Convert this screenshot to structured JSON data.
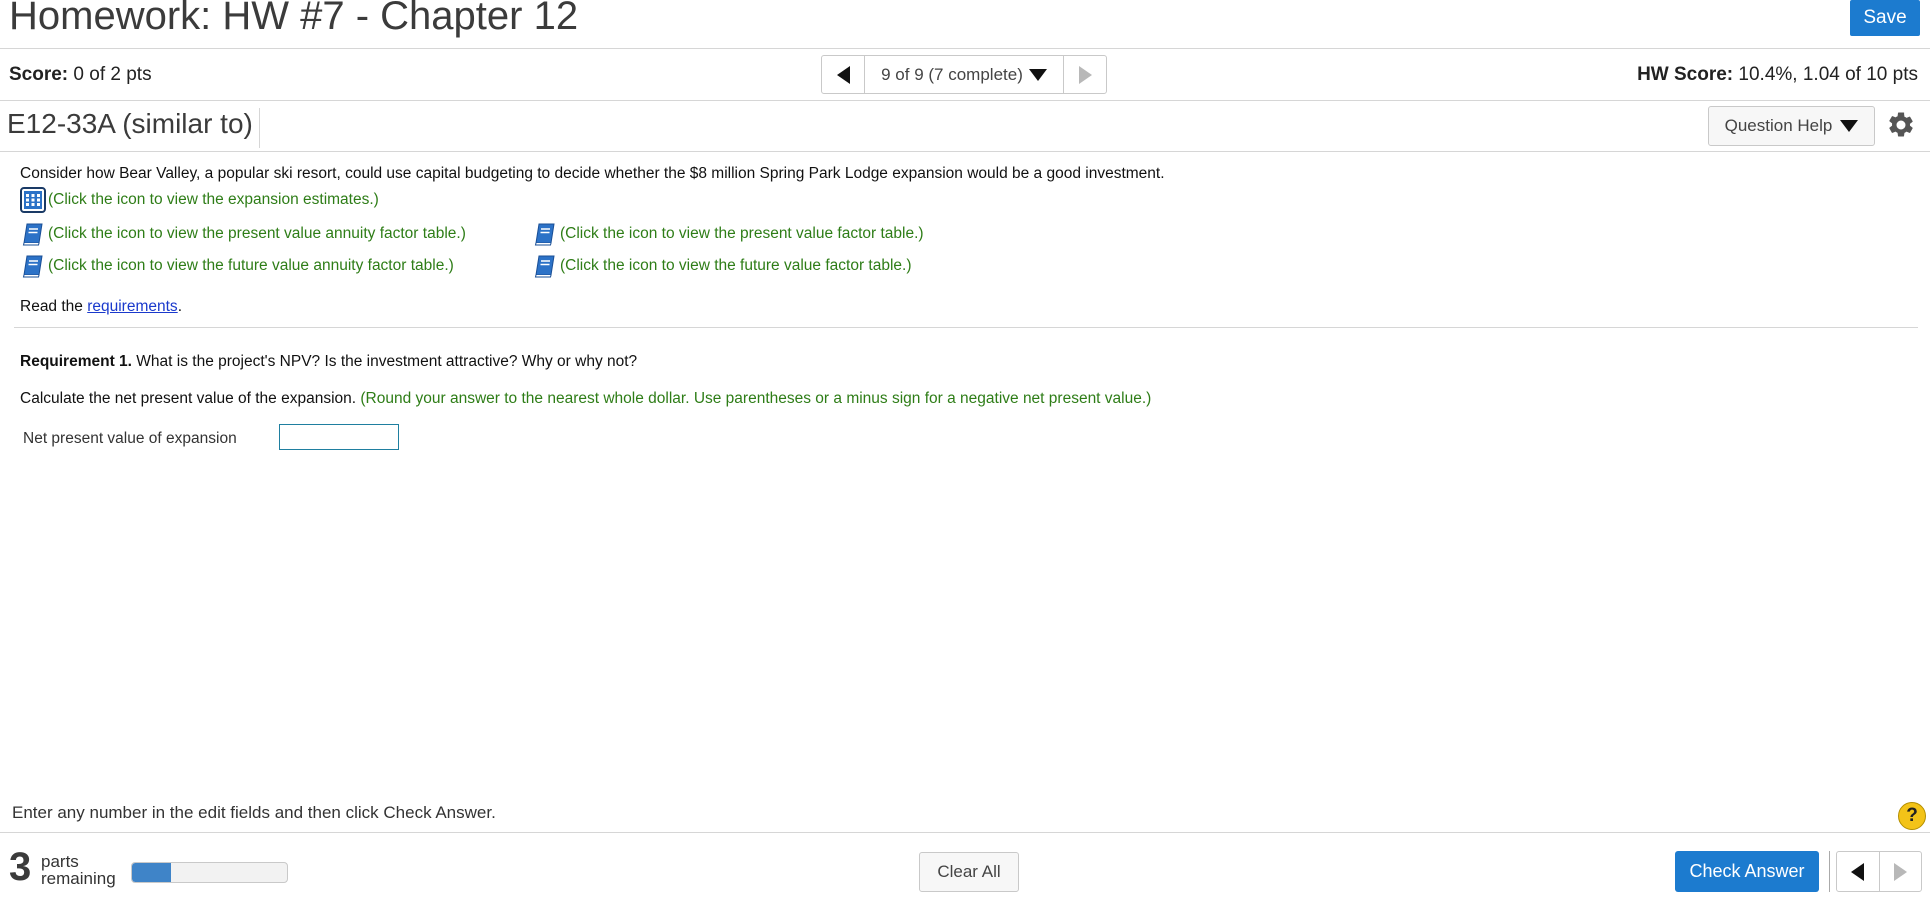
{
  "header": {
    "title": "Homework: HW #7 - Chapter 12",
    "save_label": "Save"
  },
  "score_bar": {
    "score_label": "Score:",
    "score_value": "0 of 2 pts",
    "nav_status": "9 of 9 (7 complete)",
    "hw_score_label": "HW Score:",
    "hw_score_value": "10.4%, 1.04 of 10 pts"
  },
  "question_header": {
    "question_id": "E12-33A (similar to)",
    "question_help_label": "Question Help"
  },
  "question": {
    "intro": "Consider how Bear Valley, a popular ski resort, could use capital budgeting to decide whether the $8 million Spring Park Lodge expansion would be a good investment.",
    "links": {
      "expansion_estimates": "(Click the icon to view the expansion estimates.)",
      "pv_annuity_table": "(Click the icon to view the present value annuity factor table.)",
      "pv_factor_table": "(Click the icon to view the present value factor table.)",
      "fv_annuity_table": "(Click the icon to view the future value annuity factor table.)",
      "fv_factor_table": "(Click the icon to view the future value factor table.)"
    },
    "read_prefix": "Read the ",
    "requirements_link": "requirements",
    "read_suffix": ".",
    "requirement_label": "Requirement 1.",
    "requirement_text": " What is the project's NPV? Is the investment attractive? Why or why not?",
    "calc_text": "Calculate the net present value of the expansion. ",
    "calc_hint": "(Round your answer to the nearest whole dollar. Use parentheses or a minus sign for a negative net present value.)",
    "npv_label": "Net present value of expansion",
    "npv_value": ""
  },
  "footer": {
    "message": "Enter any number in the edit fields and then click Check Answer.",
    "help_symbol": "?",
    "parts_count": "3",
    "parts_line1": "parts",
    "parts_line2": "remaining",
    "progress_fraction": 0.25,
    "clear_all_label": "Clear All",
    "check_answer_label": "Check Answer"
  },
  "colors": {
    "primary_button": "#1c7bcf",
    "link_green": "#2e7d17",
    "link_blue": "#1a39cc",
    "progress_fill": "#3f84c8",
    "help_yellow": "#f3c318"
  },
  "icons": [
    "chevron-left-icon",
    "chevron-right-icon",
    "caret-down-icon",
    "gear-icon",
    "table-grid-icon",
    "book-icon",
    "help-icon"
  ]
}
